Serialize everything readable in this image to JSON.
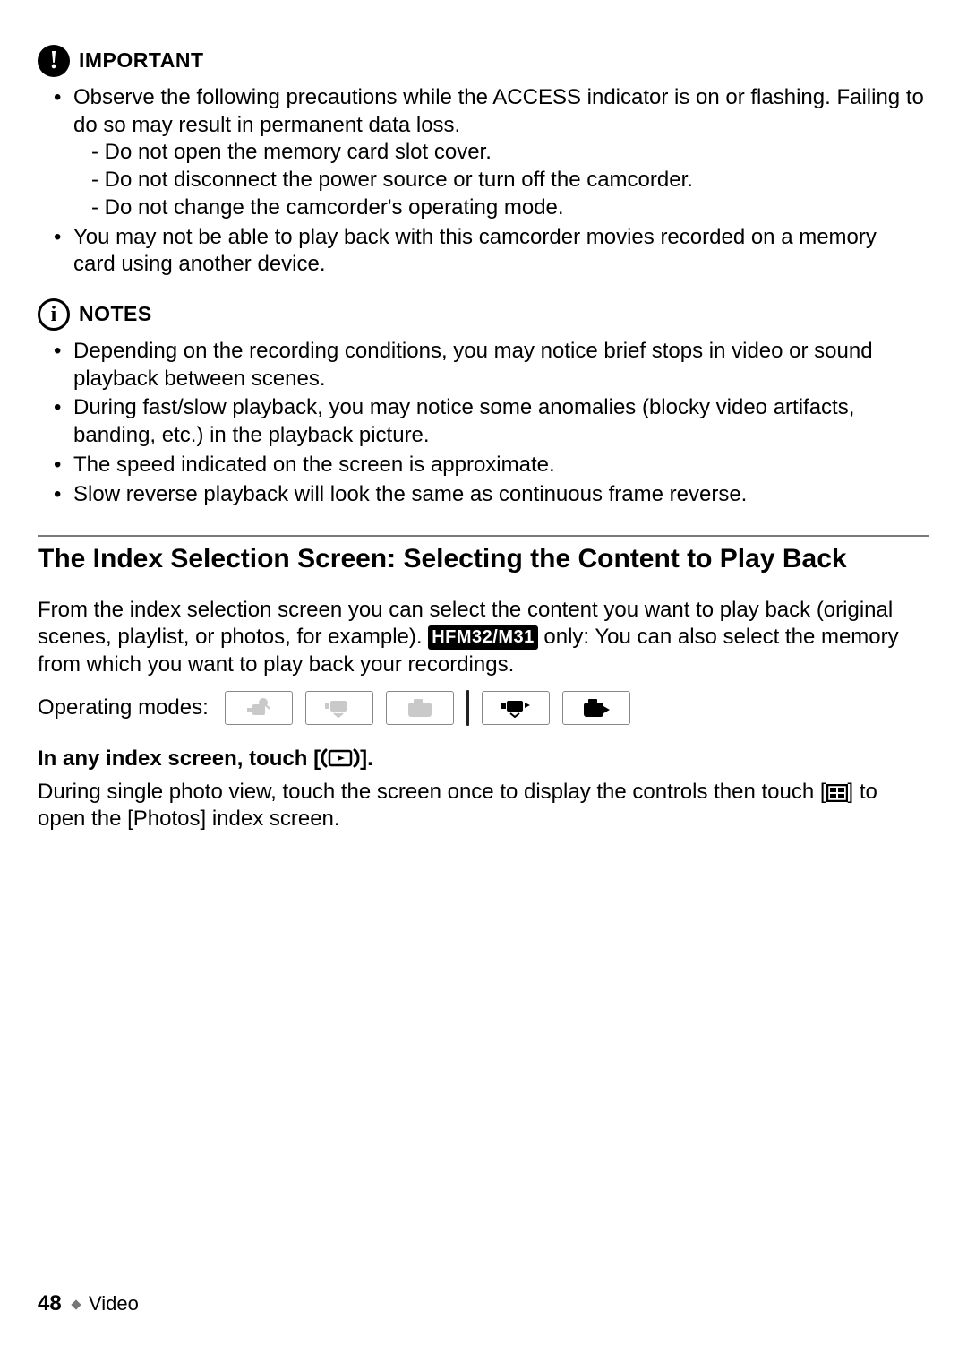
{
  "important": {
    "label": "IMPORTANT",
    "bullets": [
      {
        "text": "Observe the following precautions while the ACCESS indicator is on or flashing. Failing to do so may result in permanent data loss.",
        "sub": [
          "Do not open the memory card slot cover.",
          "Do not disconnect the power source or turn off the camcorder.",
          "Do not change the camcorder's operating mode."
        ]
      },
      {
        "text": "You may not be able to play back with this camcorder movies recorded on a memory card using another device."
      }
    ]
  },
  "notes": {
    "label": "NOTES",
    "bullets": [
      "Depending on the recording conditions, you may notice brief stops in video or sound playback between scenes.",
      "During fast/slow playback, you may notice some anomalies (blocky video artifacts, banding, etc.) in the playback picture.",
      "The speed indicated on the screen is approximate.",
      "Slow reverse playback will look the same as continuous frame reverse."
    ]
  },
  "section": {
    "title": "The Index Selection Screen: Selecting the Content to Play Back",
    "intro_part1": "From the index selection screen you can select the content you want to play back (original scenes, playlist, or photos, for example). ",
    "model_badge": "HFM32/M31",
    "intro_part2": " only: You can also select the memory from which you want to play back your recordings.",
    "modes_label": "Operating modes:",
    "step_head_pre": "In any index screen, touch [",
    "step_head_post": "].",
    "step_body_pre": "During single photo view, touch the screen once to display the controls then touch [",
    "step_body_post": "] to open the [Photos] index screen."
  },
  "footer": {
    "page": "48",
    "chapter": "Video"
  }
}
